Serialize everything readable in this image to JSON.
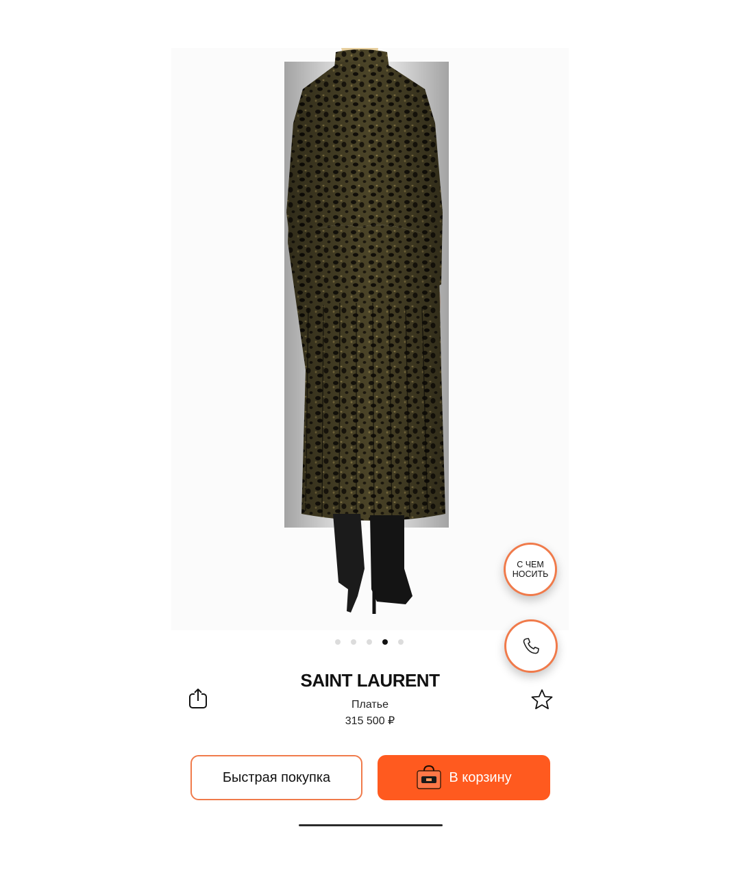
{
  "colors": {
    "accent": "#ff5a1f",
    "accent_border": "#f07a4a",
    "text": "#111111",
    "dot_active": "#111111",
    "dot_inactive": "#dcdcdc"
  },
  "gallery": {
    "image_alt": "leopard-print pleated midi dress, back view",
    "dot_count": 5,
    "active_index": 3
  },
  "floating": {
    "outfit_label": "С ЧЕМ НОСИТЬ",
    "call_icon": "phone-icon"
  },
  "product": {
    "brand": "SAINT LAURENT",
    "type": "Платье",
    "price": "315 500 ₽"
  },
  "actions": {
    "share_icon": "share-icon",
    "favorite_icon": "star-icon",
    "quick_buy_label": "Быстрая покупка",
    "cart_label": "В корзину",
    "cart_icon": "shopping-bag-icon"
  }
}
